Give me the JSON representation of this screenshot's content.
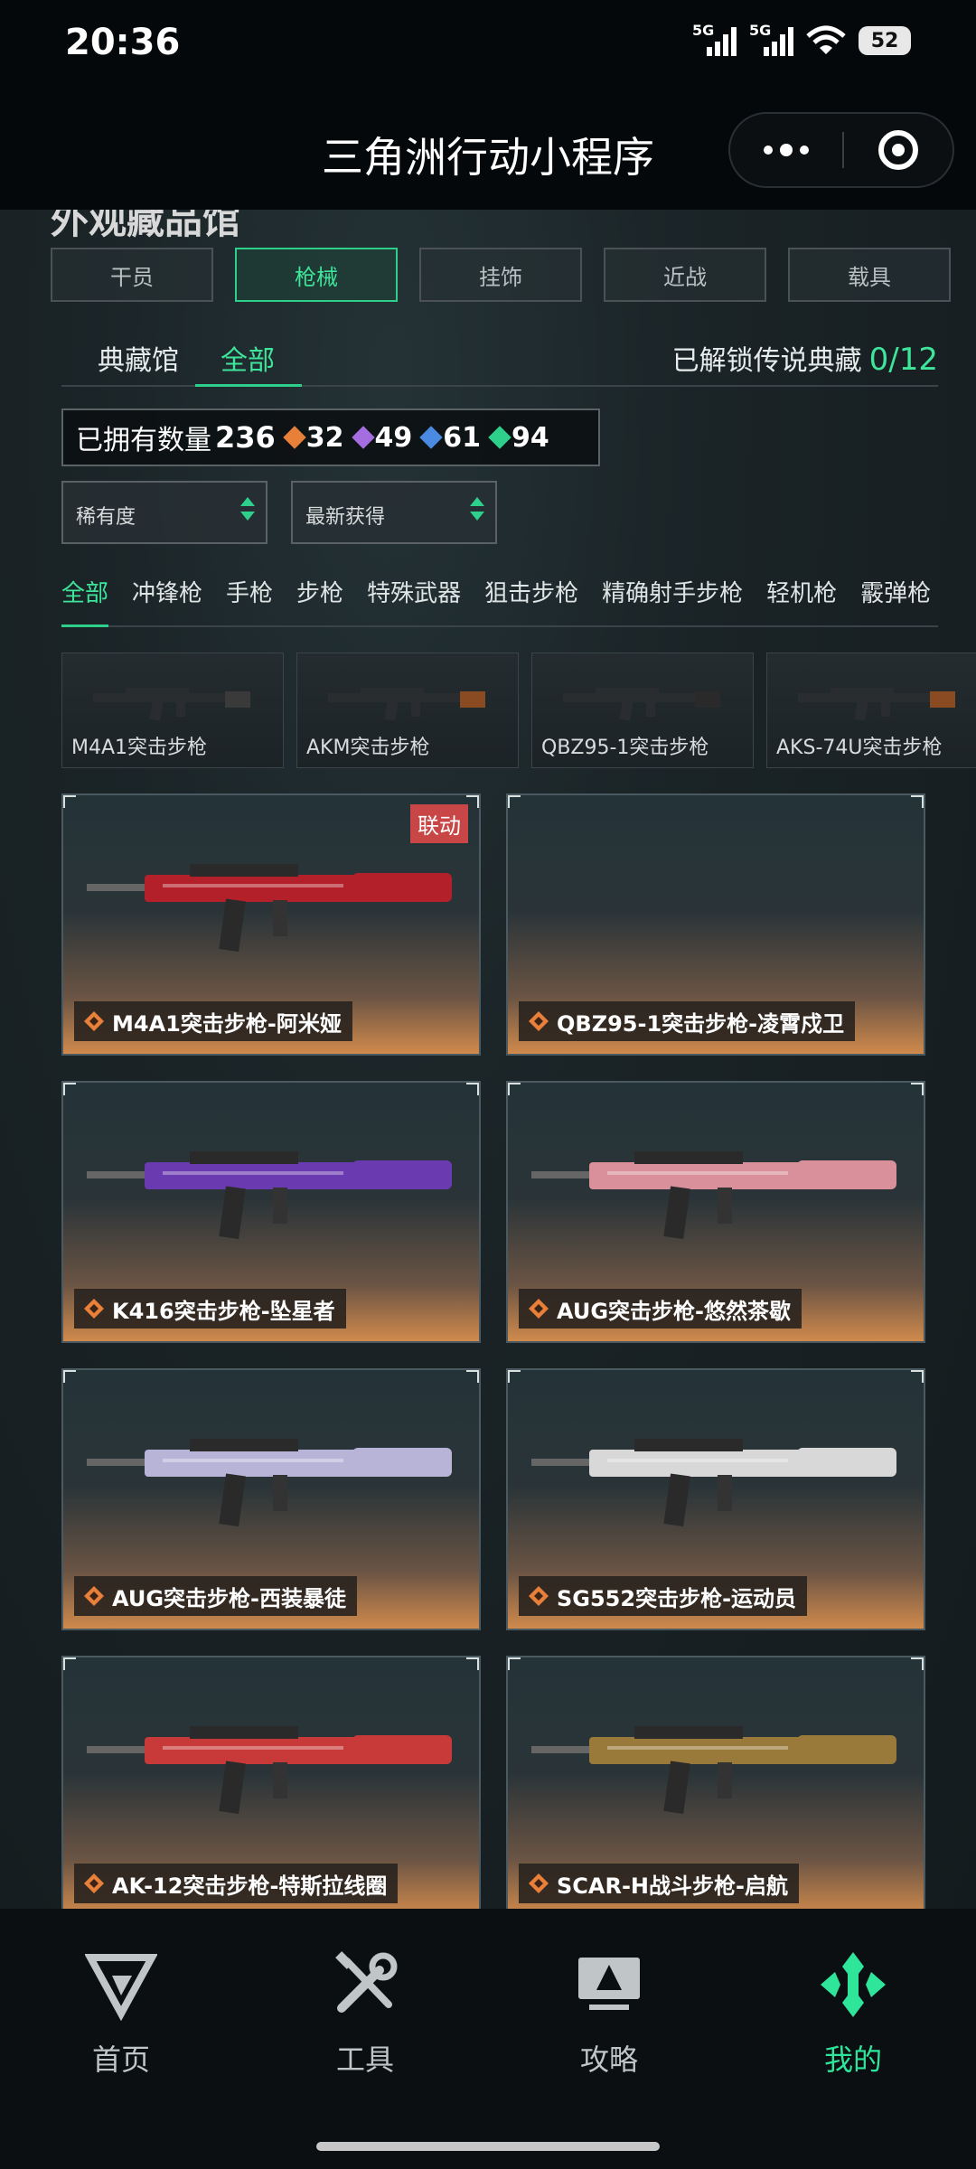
{
  "status": {
    "time": "20:36",
    "signal_labels": [
      "5G",
      "5G"
    ],
    "battery": "52"
  },
  "header": {
    "title": "三角洲行动小程序"
  },
  "page": {
    "partial_heading": "外观藏品馆",
    "category_tabs": [
      {
        "label": "干员",
        "active": false
      },
      {
        "label": "枪械",
        "active": true
      },
      {
        "label": "挂饰",
        "active": false
      },
      {
        "label": "近战",
        "active": false
      },
      {
        "label": "载具",
        "active": false
      }
    ],
    "sub_tabs": [
      {
        "label": "典藏馆",
        "active": false
      },
      {
        "label": "全部",
        "active": true
      }
    ],
    "unlock_label": "已解锁传说典藏",
    "unlock_count": "0/12",
    "owned": {
      "label": "已拥有数量",
      "total": "236",
      "rarities": [
        {
          "color": "#e8803a",
          "count": "32"
        },
        {
          "color": "#a46ee0",
          "count": "49"
        },
        {
          "color": "#4a8ae0",
          "count": "61"
        },
        {
          "color": "#2ecf8a",
          "count": "94"
        }
      ]
    },
    "filters": {
      "rarity": "稀有度",
      "sort": "最新获得"
    },
    "type_tabs": [
      {
        "label": "全部",
        "active": true
      },
      {
        "label": "冲锋枪",
        "active": false
      },
      {
        "label": "手枪",
        "active": false
      },
      {
        "label": "步枪",
        "active": false
      },
      {
        "label": "特殊武器",
        "active": false
      },
      {
        "label": "狙击步枪",
        "active": false
      },
      {
        "label": "精确射手步枪",
        "active": false
      },
      {
        "label": "轻机枪",
        "active": false
      },
      {
        "label": "霰弹枪",
        "active": false
      }
    ],
    "base_weapons": [
      {
        "name": "M4A1突击步枪"
      },
      {
        "name": "AKM突击步枪"
      },
      {
        "name": "QBZ95-1突击步枪"
      },
      {
        "name": "AKS-74U突击步枪"
      }
    ],
    "skins": [
      {
        "name": "M4A1突击步枪-阿米娅",
        "badge": "联动",
        "accent": "#b3202a"
      },
      {
        "name": "QBZ95-1突击步枪-凌霄戍卫",
        "badge": "",
        "accent": ""
      },
      {
        "name": "K416突击步枪-坠星者",
        "badge": "",
        "accent": "#6a3ab0"
      },
      {
        "name": "AUG突击步枪-悠然茶歇",
        "badge": "",
        "accent": "#d9909a"
      },
      {
        "name": "AUG突击步枪-西装暴徒",
        "badge": "",
        "accent": "#b8b4d8"
      },
      {
        "name": "SG552突击步枪-运动员",
        "badge": "",
        "accent": "#d8d8d8"
      },
      {
        "name": "AK-12突击步枪-特斯拉线圈",
        "badge": "",
        "accent": "#c83a3a"
      },
      {
        "name": "SCAR-H战斗步枪-启航",
        "badge": "",
        "accent": "#9a7a3a"
      }
    ]
  },
  "nav": {
    "items": [
      {
        "label": "首页",
        "icon": "home-logo-icon",
        "active": false
      },
      {
        "label": "工具",
        "icon": "tools-icon",
        "active": false
      },
      {
        "label": "攻略",
        "icon": "guide-icon",
        "active": false
      },
      {
        "label": "我的",
        "icon": "profile-logo-icon",
        "active": true
      }
    ]
  }
}
